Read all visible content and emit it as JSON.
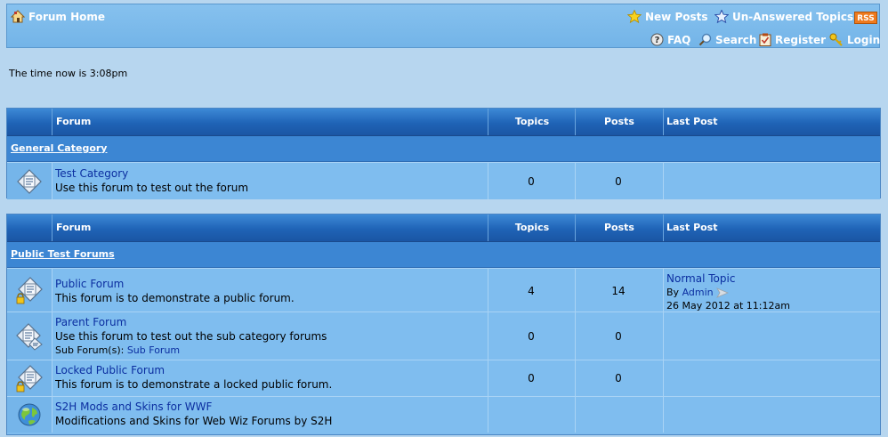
{
  "nav": {
    "forum_home": "Forum Home",
    "new_posts": "New Posts",
    "unanswered_topics": "Un-Answered Topics",
    "rss": "RSS",
    "faq": "FAQ",
    "search": "Search",
    "register": "Register",
    "login": "Login"
  },
  "time_now": "The time now is 3:08pm",
  "headers": {
    "forum": "Forum",
    "topics": "Topics",
    "posts": "Posts",
    "last_post": "Last Post"
  },
  "categories": [
    {
      "name": "General Category",
      "forums": [
        {
          "title": "Test Category",
          "description": "Use this forum to test out the forum",
          "topics": "0",
          "posts": "0",
          "icon": "forum-icon"
        }
      ]
    },
    {
      "name": "Public Test Forums",
      "forums": [
        {
          "title": "Public Forum",
          "description": "This forum is to demonstrate a public forum.",
          "topics": "4",
          "posts": "14",
          "icon": "forum-lock-icon",
          "last_post": {
            "topic": "Normal Topic",
            "by": "By",
            "author": "Admin",
            "date": "26 May 2012 at 11:12am"
          }
        },
        {
          "title": "Parent Forum",
          "description": "Use this forum to test out the sub category forums",
          "topics": "0",
          "posts": "0",
          "icon": "forum-sub-icon",
          "sub_label": "Sub Forum(s):",
          "sub_forum": "Sub Forum"
        },
        {
          "title": "Locked Public Forum",
          "description": "This forum is to demonstrate a locked public forum.",
          "topics": "0",
          "posts": "0",
          "icon": "forum-lock-icon"
        },
        {
          "title": "S2H Mods and Skins for WWF",
          "description": "Modifications and Skins for Web Wiz Forums by S2H",
          "icon": "globe-icon"
        }
      ]
    }
  ]
}
